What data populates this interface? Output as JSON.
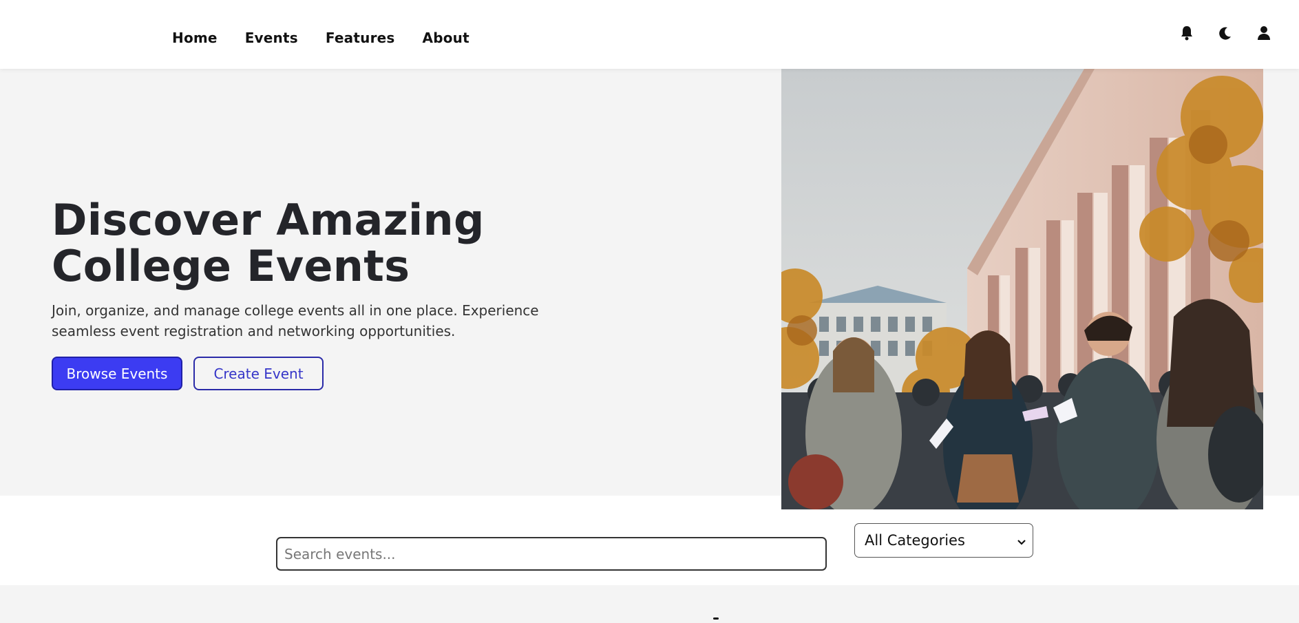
{
  "nav": {
    "links": [
      "Home",
      "Events",
      "Features",
      "About"
    ],
    "icons": [
      "bell-icon",
      "moon-icon",
      "user-icon"
    ]
  },
  "hero": {
    "title_line1": "Discover Amazing",
    "title_line2": "College Events",
    "subtitle_line1": "Join, organize, and manage college events all in one place. Experience",
    "subtitle_line2": "seamless event registration and networking opportunities.",
    "primary_button": "Browse Events",
    "secondary_button": "Create Event"
  },
  "search": {
    "placeholder": "Search events...",
    "category_selected": "All Categories"
  },
  "colors": {
    "accent": "#3c3cf2",
    "hero_bg": "#f4f4f4",
    "text_dark": "#24252a"
  }
}
